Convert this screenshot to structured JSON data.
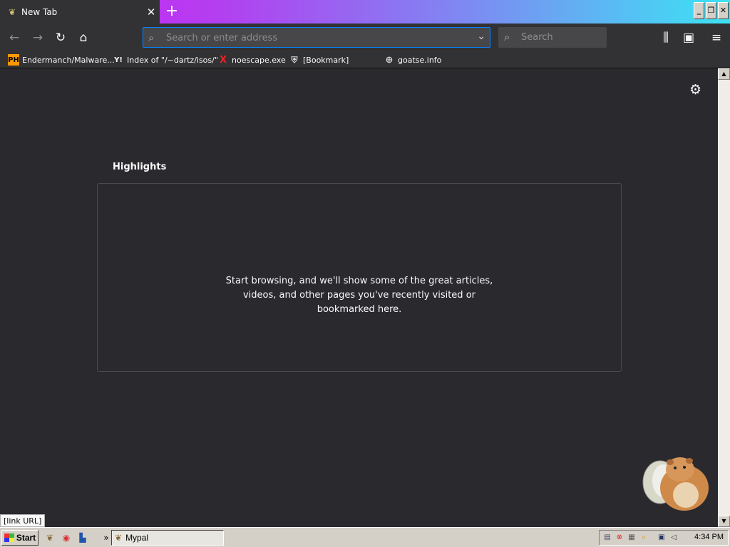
{
  "tab": {
    "title": "New Tab",
    "close_symbol": "✕",
    "favicon": "moth-icon"
  },
  "new_tab_symbol": "+",
  "window_buttons": {
    "minimize": "_",
    "restore": "❐",
    "close": "✕"
  },
  "nav": {
    "back_icon": "←",
    "forward_icon": "→",
    "reload_icon": "↻",
    "home_icon": "⌂",
    "url_placeholder": "Search or enter address",
    "url_dropdown": "⌄",
    "search_placeholder": "Search",
    "library_icon": "⫼",
    "sidebar_icon": "▣",
    "menu_icon": "≡"
  },
  "bookmarks": [
    {
      "icon_text": "PH",
      "label": "Endermanch/Malware..."
    },
    {
      "icon_text": "Y!",
      "label": "Index of \"/~dartz/isos/\""
    },
    {
      "icon_text": "X",
      "label": "noescape.exe"
    },
    {
      "icon_text": "⛨",
      "label": "[Bookmark]"
    },
    {
      "icon_text": "⊕",
      "label": "goatse.info"
    }
  ],
  "highlights": {
    "title": "Highlights",
    "message_lines": [
      "Start browsing, and we'll show some of the great articles,",
      "videos, and other pages you've recently visited or",
      "bookmarked here."
    ]
  },
  "gear_icon": "⚙",
  "status_url": "[link URL]",
  "taskbar": {
    "start_label": "Start",
    "chevron": "»",
    "task_label": "Mypal",
    "clock": "4:34 PM"
  },
  "colors": {
    "tab_gradient_start": "#d21cf5",
    "tab_gradient_end": "#3be3f4",
    "content_bg": "#2a2a2e",
    "toolbar_bg": "#323234",
    "focus_blue": "#0a84ff"
  }
}
